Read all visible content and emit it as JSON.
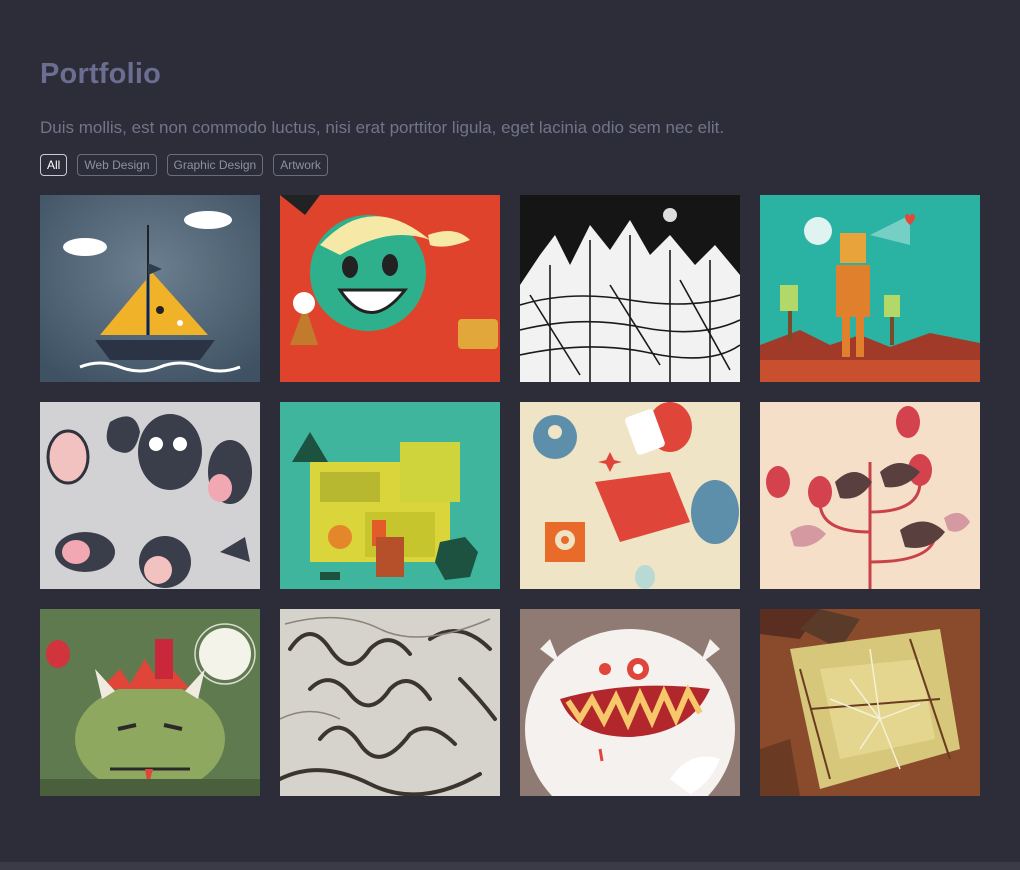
{
  "portfolio": {
    "title": "Portfolio",
    "subtitle": "Duis mollis, est non commodo luctus, nisi erat porttitor ligula, eget lacinia odio sem nec elit.",
    "filters": [
      {
        "label": "All",
        "active": true
      },
      {
        "label": "Web Design",
        "active": false
      },
      {
        "label": "Graphic Design",
        "active": false
      },
      {
        "label": "Artwork",
        "active": false
      }
    ],
    "items": [
      {
        "subject": "sailboat-illustration",
        "bg": "#4f6374"
      },
      {
        "subject": "smiling-girl-illustration",
        "bg": "#e0432c"
      },
      {
        "subject": "city-sketch-illustration",
        "bg": "#1e1e1e"
      },
      {
        "subject": "robot-desert-illustration",
        "bg": "#2ab2a2"
      },
      {
        "subject": "monsters-pattern-illustration",
        "bg": "#d2d2d4"
      },
      {
        "subject": "sdk-ide-illustration",
        "bg": "#3fb59d"
      },
      {
        "subject": "robots-pattern-illustration",
        "bg": "#efe4c6"
      },
      {
        "subject": "hens-eggs-illustration",
        "bg": "#f6dfc8"
      },
      {
        "subject": "monster-castle-illustration",
        "bg": "#5f7a4f"
      },
      {
        "subject": "ribbon-lettering-illustration",
        "bg": "#d5d3cc"
      },
      {
        "subject": "white-monster-illustration",
        "bg": "#8f7b74"
      },
      {
        "subject": "broken-glass-illustration",
        "bg": "#8a4a2c"
      }
    ]
  }
}
